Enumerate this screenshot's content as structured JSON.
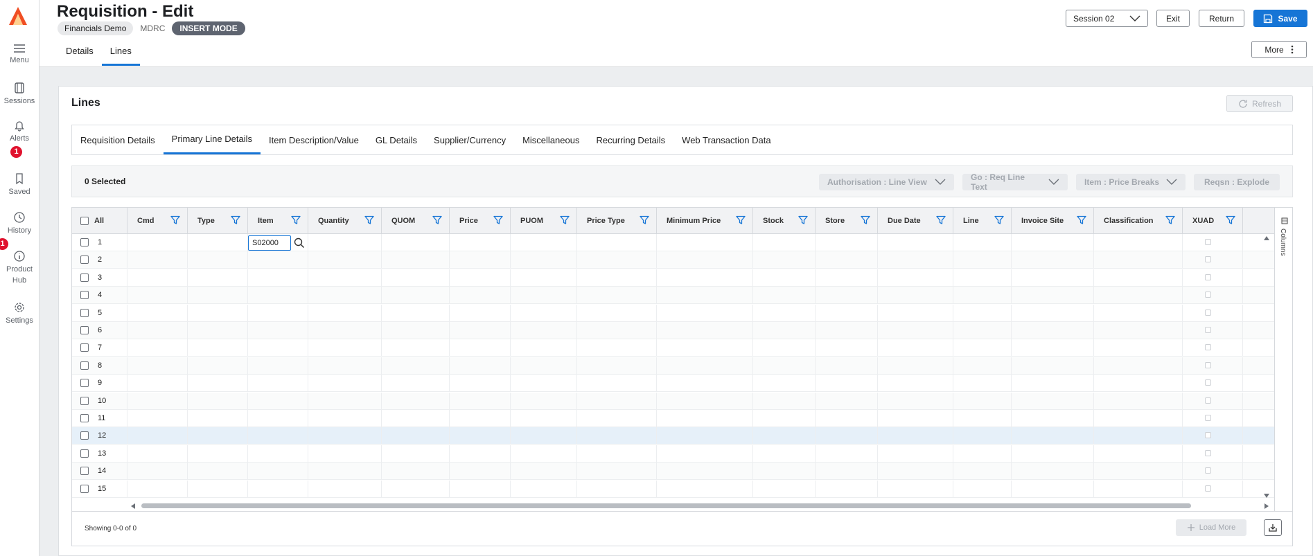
{
  "rail": {
    "items": [
      {
        "label": "Menu"
      },
      {
        "label": "Sessions"
      },
      {
        "label": "Alerts",
        "badge": "1"
      },
      {
        "label": "Saved"
      },
      {
        "label": "History",
        "badge": "1"
      },
      {
        "label": "Product Hub"
      },
      {
        "label": "Settings"
      }
    ]
  },
  "header": {
    "title": "Requisition - Edit",
    "chip_company": "Financials Demo",
    "chip_code": "MDRC",
    "chip_mode": "INSERT MODE",
    "tabs": [
      {
        "label": "Details"
      },
      {
        "label": "Lines",
        "active": true
      }
    ],
    "session_select": "Session 02",
    "exit_label": "Exit",
    "return_label": "Return",
    "save_label": "Save",
    "more_label": "More"
  },
  "lines": {
    "title": "Lines",
    "refresh_label": "Refresh",
    "tabs": [
      {
        "label": "Requisition Details"
      },
      {
        "label": "Primary Line Details",
        "active": true
      },
      {
        "label": "Item Description/Value"
      },
      {
        "label": "GL Details"
      },
      {
        "label": "Supplier/Currency"
      },
      {
        "label": "Miscellaneous"
      },
      {
        "label": "Recurring Details"
      },
      {
        "label": "Web Transaction Data"
      }
    ],
    "selected_text": "0 Selected",
    "actions": [
      {
        "label": "Authorisation : Line View"
      },
      {
        "label": "Go : Req Line Text"
      },
      {
        "label": "Item : Price Breaks"
      },
      {
        "label": "Reqsn : Explode"
      }
    ]
  },
  "grid": {
    "select_all_label": "All",
    "columns": [
      "Cmd",
      "Type",
      "Item",
      "Quantity",
      "QUOM",
      "Price",
      "PUOM",
      "Price Type",
      "Minimum Price",
      "Stock",
      "Store",
      "Due Date",
      "Line",
      "Invoice Site",
      "Classification",
      "XUAD"
    ],
    "rows": [
      "1",
      "2",
      "3",
      "4",
      "5",
      "6",
      "7",
      "8",
      "9",
      "10",
      "11",
      "12",
      "13",
      "14",
      "15"
    ],
    "highlighted_row": "12",
    "edit_item_value": "S02000",
    "columns_panel_label": "Columns"
  },
  "footer": {
    "showing": "Showing 0-0 of 0",
    "load_more_label": "Load More"
  },
  "colors": {
    "accent": "#1675d6",
    "badge": "#e0122e",
    "mode_chip": "#5e6470",
    "logo": "#f04e23"
  }
}
